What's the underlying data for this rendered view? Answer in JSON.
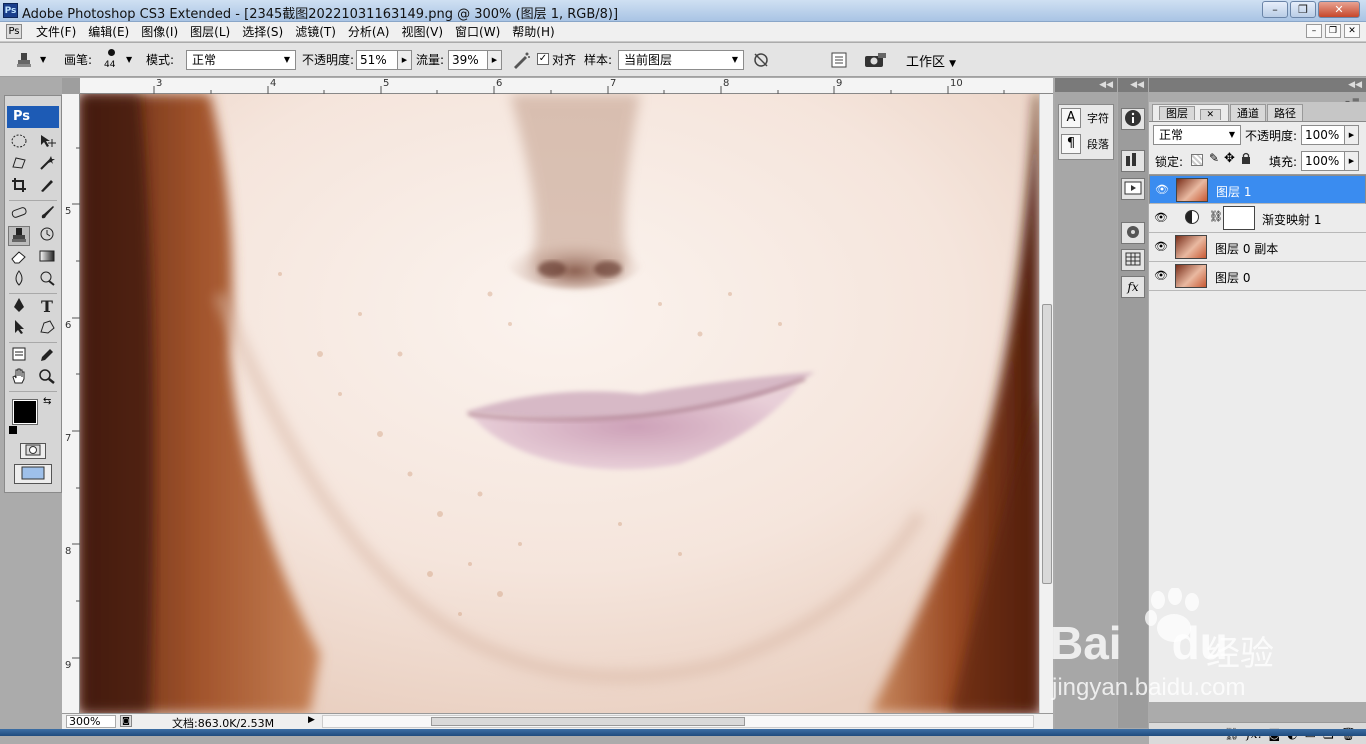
{
  "window": {
    "title": "Adobe Photoshop CS3 Extended - [2345截图20221031163149.png @ 300% (图层 1, RGB/8)]",
    "app_icon": "Ps"
  },
  "menu": [
    "文件(F)",
    "编辑(E)",
    "图像(I)",
    "图层(L)",
    "选择(S)",
    "滤镜(T)",
    "分析(A)",
    "视图(V)",
    "窗口(W)",
    "帮助(H)"
  ],
  "options": {
    "brush_label": "画笔:",
    "brush_size": "44",
    "mode_label": "模式:",
    "mode_value": "正常",
    "opacity_label": "不透明度:",
    "opacity_value": "51%",
    "flow_label": "流量:",
    "flow_value": "39%",
    "align_label": "对齐",
    "align_checked": true,
    "sample_label": "样本:",
    "sample_value": "当前图层",
    "workspace_label": "工作区"
  },
  "toolbox": {
    "logo": "Ps",
    "tools": [
      "marquee-tool",
      "move-tool",
      "lasso-tool",
      "magic-wand-tool",
      "crop-tool",
      "slice-tool",
      "healing-brush-tool",
      "brush-tool",
      "clone-stamp-tool",
      "history-brush-tool",
      "eraser-tool",
      "gradient-tool",
      "blur-tool",
      "dodge-tool",
      "pen-tool",
      "type-tool",
      "path-selection-tool",
      "shape-tool",
      "notes-tool",
      "eyedropper-tool",
      "hand-tool",
      "zoom-tool"
    ],
    "active_tool": "clone-stamp-tool",
    "foreground": "#000000",
    "background": "#ffffff"
  },
  "rulers": {
    "horizontal": [
      "3",
      "4",
      "5",
      "6",
      "7",
      "8",
      "9",
      "10"
    ],
    "vertical": [
      "5",
      "6",
      "7",
      "8",
      "9"
    ]
  },
  "status": {
    "zoom": "300%",
    "doc": "文档:863.0K/2.53M"
  },
  "char_panel": {
    "char_label": "字符",
    "para_label": "段落"
  },
  "layers_panel": {
    "tabs": [
      "图层",
      "通道",
      "路径"
    ],
    "active_tab": "图层",
    "blend_mode": "正常",
    "opacity_label": "不透明度:",
    "opacity": "100%",
    "lock_label": "锁定:",
    "fill_label": "填充:",
    "fill": "100%",
    "layers": [
      {
        "name": "图层 1",
        "selected": true,
        "type": "pixel"
      },
      {
        "name": "渐变映射 1",
        "selected": false,
        "type": "adjustment"
      },
      {
        "name": "图层 0 副本",
        "selected": false,
        "type": "pixel"
      },
      {
        "name": "图层 0",
        "selected": false,
        "type": "pixel"
      }
    ]
  },
  "watermark": {
    "brand": "Bai",
    "brand2": "du",
    "product": "经验",
    "url": "jingyan.baidu.com"
  },
  "colors": {
    "selection": "#3a8cf0",
    "logo_blue": "#1d5bb5"
  }
}
